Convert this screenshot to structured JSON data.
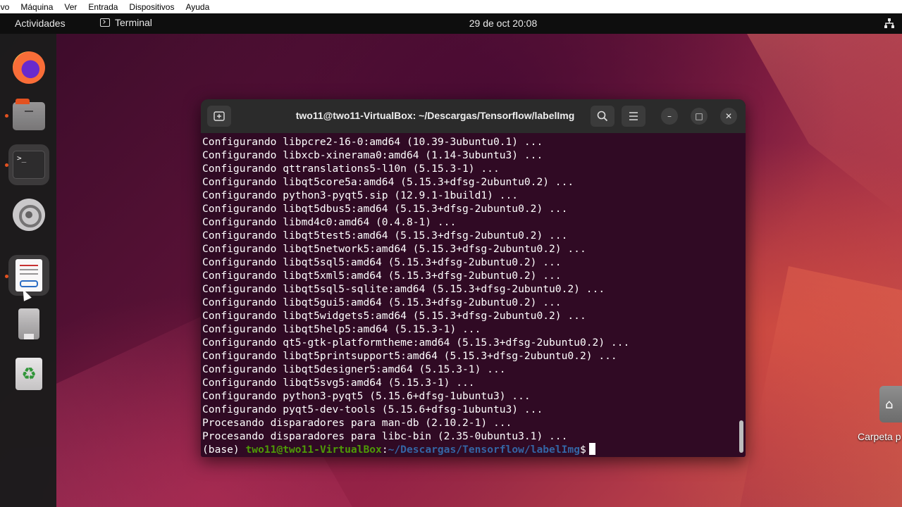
{
  "vbox_menu": [
    "ivo",
    "Máquina",
    "Ver",
    "Entrada",
    "Dispositivos",
    "Ayuda"
  ],
  "topbar": {
    "activities": "Actividades",
    "app_name": "Terminal",
    "clock": "29 de oct  20:08",
    "network_icon": "network-icon"
  },
  "dock": {
    "items": [
      "firefox",
      "files",
      "terminal",
      "settings",
      "labelimg",
      "usb-drive",
      "trash"
    ]
  },
  "desktop": {
    "folder_label": "Carpeta p"
  },
  "terminal": {
    "title": "two11@two11-VirtualBox: ~/Descargas/Tensorflow/labelImg",
    "lines": [
      "Configurando libpcre2-16-0:amd64 (10.39-3ubuntu0.1) ...",
      "Configurando libxcb-xinerama0:amd64 (1.14-3ubuntu3) ...",
      "Configurando qttranslations5-l10n (5.15.3-1) ...",
      "Configurando libqt5core5a:amd64 (5.15.3+dfsg-2ubuntu0.2) ...",
      "Configurando python3-pyqt5.sip (12.9.1-1build1) ...",
      "Configurando libqt5dbus5:amd64 (5.15.3+dfsg-2ubuntu0.2) ...",
      "Configurando libmd4c0:amd64 (0.4.8-1) ...",
      "Configurando libqt5test5:amd64 (5.15.3+dfsg-2ubuntu0.2) ...",
      "Configurando libqt5network5:amd64 (5.15.3+dfsg-2ubuntu0.2) ...",
      "Configurando libqt5sql5:amd64 (5.15.3+dfsg-2ubuntu0.2) ...",
      "Configurando libqt5xml5:amd64 (5.15.3+dfsg-2ubuntu0.2) ...",
      "Configurando libqt5sql5-sqlite:amd64 (5.15.3+dfsg-2ubuntu0.2) ...",
      "Configurando libqt5gui5:amd64 (5.15.3+dfsg-2ubuntu0.2) ...",
      "Configurando libqt5widgets5:amd64 (5.15.3+dfsg-2ubuntu0.2) ...",
      "Configurando libqt5help5:amd64 (5.15.3-1) ...",
      "Configurando qt5-gtk-platformtheme:amd64 (5.15.3+dfsg-2ubuntu0.2) ...",
      "Configurando libqt5printsupport5:amd64 (5.15.3+dfsg-2ubuntu0.2) ...",
      "Configurando libqt5designer5:amd64 (5.15.3-1) ...",
      "Configurando libqt5svg5:amd64 (5.15.3-1) ...",
      "Configurando python3-pyqt5 (5.15.6+dfsg-1ubuntu3) ...",
      "Configurando pyqt5-dev-tools (5.15.6+dfsg-1ubuntu3) ...",
      "Procesando disparadores para man-db (2.10.2-1) ...",
      "Procesando disparadores para libc-bin (2.35-0ubuntu3.1) ..."
    ],
    "prompt": {
      "env": "(base) ",
      "user_host": "two11@two11-VirtualBox",
      "separator": ":",
      "path": "~/Descargas/Tensorflow/labelImg",
      "symbol": "$"
    },
    "colors": {
      "background": "#300a24",
      "user_host": "#4e9a06",
      "path": "#3465a4"
    }
  }
}
